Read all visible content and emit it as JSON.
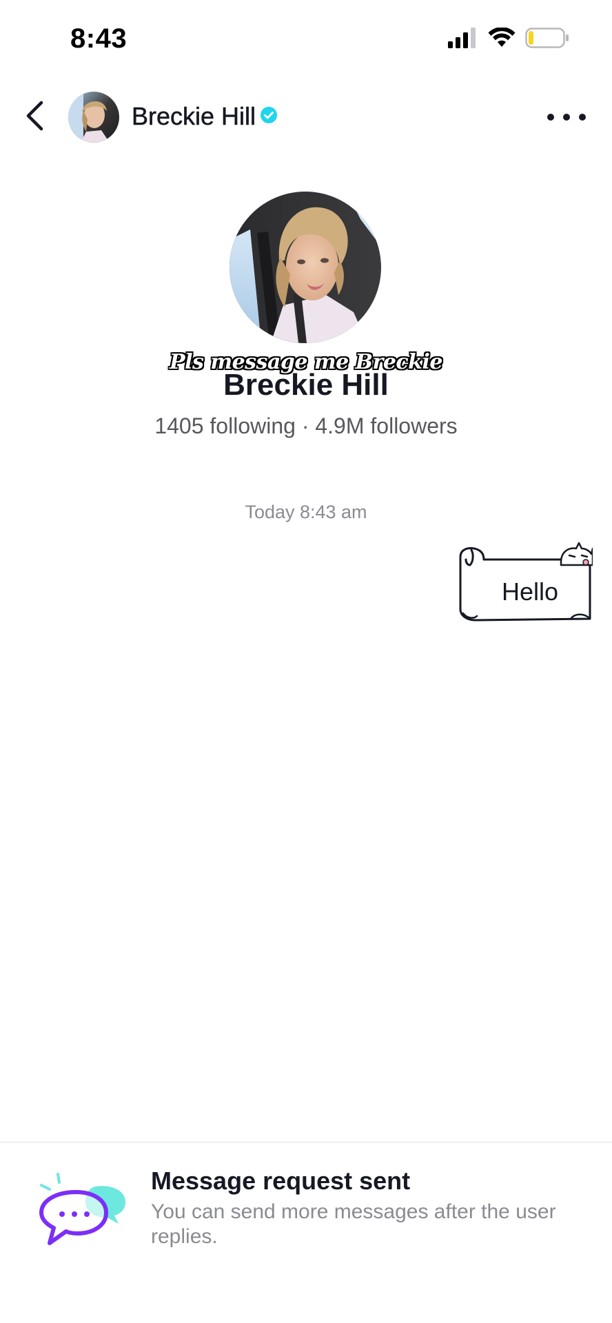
{
  "status_bar": {
    "time": "8:43",
    "icons": [
      "cellular-signal-icon",
      "wifi-icon",
      "battery-icon"
    ],
    "battery_level": 0.15
  },
  "header": {
    "back_icon": "chevron-left-icon",
    "name": "Breckie Hill",
    "verified_icon": "verified-badge-icon",
    "more_icon": "more-horizontal-icon"
  },
  "profile": {
    "sticker_caption": "Pls message me Breckie",
    "name": "Breckie Hill",
    "stats": "1405 following · 4.9M followers"
  },
  "conversation": {
    "timestamp": "Today 8:43 am",
    "messages": [
      {
        "sender": "me",
        "text": "Hello"
      }
    ]
  },
  "notice": {
    "icon": "chat-bubbles-icon",
    "title": "Message request sent",
    "subtitle": "You can send more messages after the user replies."
  },
  "colors": {
    "verified": "#20d5ec",
    "accent_purple": "#7b2ff7",
    "accent_teal": "#6de8df",
    "text_primary": "#161823",
    "text_secondary": "#8a8b91"
  }
}
